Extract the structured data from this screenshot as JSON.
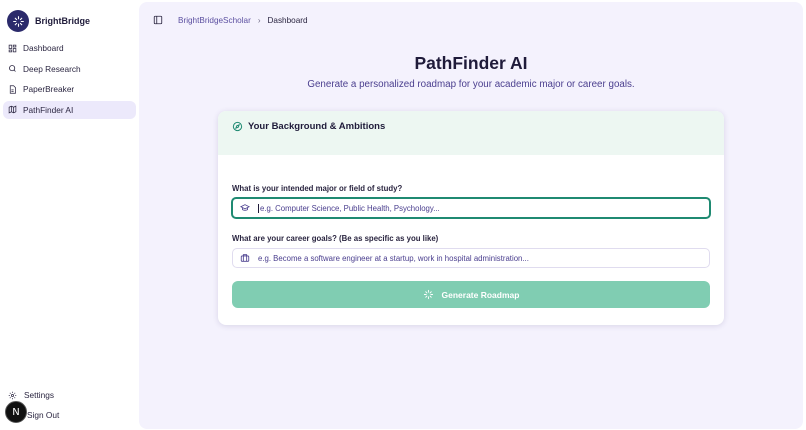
{
  "brand": {
    "name": "BrightBridge",
    "logo_icon": "sparkle-icon",
    "logo_color": "#2b2a6b"
  },
  "sidebar": {
    "items": [
      {
        "label": "Dashboard",
        "icon": "dashboard-icon",
        "active": false
      },
      {
        "label": "Deep Research",
        "icon": "search-icon",
        "active": false
      },
      {
        "label": "PaperBreaker",
        "icon": "document-icon",
        "active": false
      },
      {
        "label": "PathFinder AI",
        "icon": "map-icon",
        "active": true
      }
    ],
    "settings_label": "Settings",
    "signout_label": "Sign Out",
    "badge_letter": "N"
  },
  "topbar": {
    "breadcrumb": [
      "BrightBridgeScholar",
      "Dashboard"
    ]
  },
  "page": {
    "title": "PathFinder AI",
    "subtitle": "Generate a personalized roadmap for your academic major or career goals."
  },
  "card": {
    "header_title": "Your Background & Ambitions",
    "major_label": "What is your intended major or field of study?",
    "major_placeholder": "e.g. Computer Science, Public Health, Psychology...",
    "goals_label": "What are your career goals? (Be as specific as you like)",
    "goals_placeholder": "e.g. Become a software engineer at a startup, work in hospital administration...",
    "generate_label": "Generate Roadmap"
  },
  "colors": {
    "accent": "#1f8a72",
    "button": "#80cdb2",
    "active_nav": "#ece9fb",
    "main_bg": "#f4f2fd"
  }
}
